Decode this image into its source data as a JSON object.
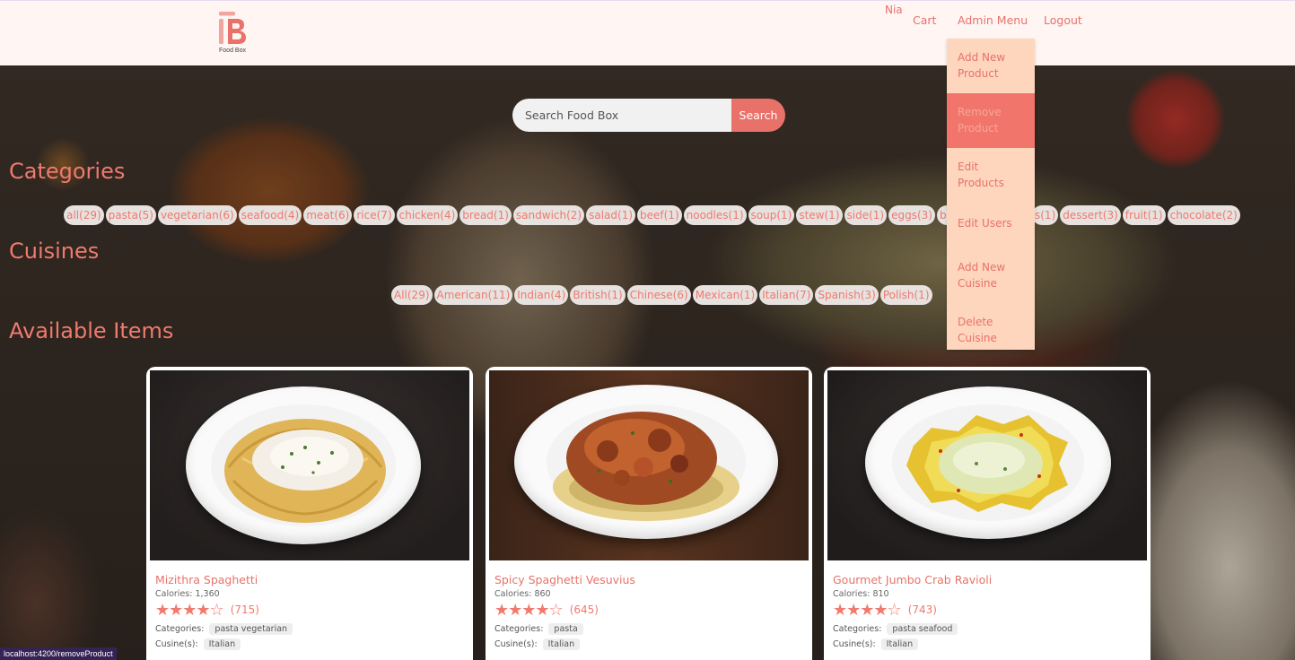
{
  "brand": {
    "logo_text": "Food Box",
    "accent": "#e8726a"
  },
  "header": {
    "user_name": "Nia",
    "nav": {
      "cart": "Cart",
      "admin_menu": "Admin Menu",
      "logout": "Logout"
    }
  },
  "admin_menu": {
    "items": [
      {
        "line1": "Add New",
        "line2": "Product"
      },
      {
        "line1": "Remove",
        "line2": "Product"
      },
      {
        "line1": "Edit",
        "line2": "Products"
      },
      {
        "line1": "Edit Users",
        "line2": ""
      },
      {
        "line1": "Add New",
        "line2": "Cuisine"
      },
      {
        "line1": "Delete",
        "line2": "Cuisine"
      }
    ],
    "hovered_item": "Remove Product"
  },
  "search": {
    "placeholder": "Search Food Box",
    "button": "Search"
  },
  "categories": {
    "title": "Categories",
    "chips": [
      "all(29)",
      "pasta(5)",
      "vegetarian(6)",
      "seafood(4)",
      "meat(6)",
      "rice(7)",
      "chicken(4)",
      "bread(1)",
      "sandwich(2)",
      "salad(1)",
      "beef(1)",
      "noodles(1)",
      "soup(1)",
      "stew(1)",
      "side(1)",
      "eggs(3)",
      "break",
      "s(1)",
      "dessert(3)",
      "fruit(1)",
      "chocolate(2)"
    ]
  },
  "cuisines": {
    "title": "Cuisines",
    "chips": [
      "All(29)",
      "American(11)",
      "Indian(4)",
      "British(1)",
      "Chinese(6)",
      "Mexican(1)",
      "Italian(7)",
      "Spanish(3)",
      "Polish(1)"
    ]
  },
  "available": {
    "title": "Available Items",
    "labels": {
      "categories": "Categories:",
      "cuisines": "Cusine(s):"
    },
    "items": [
      {
        "name": "Mizithra Spaghetti",
        "calories": "Calories: 1,360",
        "stars": "★★★★☆",
        "rating": 4,
        "count": "(715)",
        "categories": "pasta vegetarian",
        "cuisine": "Italian"
      },
      {
        "name": "Spicy Spaghetti Vesuvius",
        "calories": "Calories: 860",
        "stars": "★★★★☆",
        "rating": 4,
        "count": "(645)",
        "categories": "pasta",
        "cuisine": "Italian"
      },
      {
        "name": "Gourmet Jumbo Crab Ravioli",
        "calories": "Calories: 810",
        "stars": "★★★★☆",
        "rating": 4,
        "count": "(743)",
        "categories": "pasta seafood",
        "cuisine": "Italian"
      }
    ]
  },
  "status_bar": {
    "url": "localhost:4200/removeProduct"
  }
}
